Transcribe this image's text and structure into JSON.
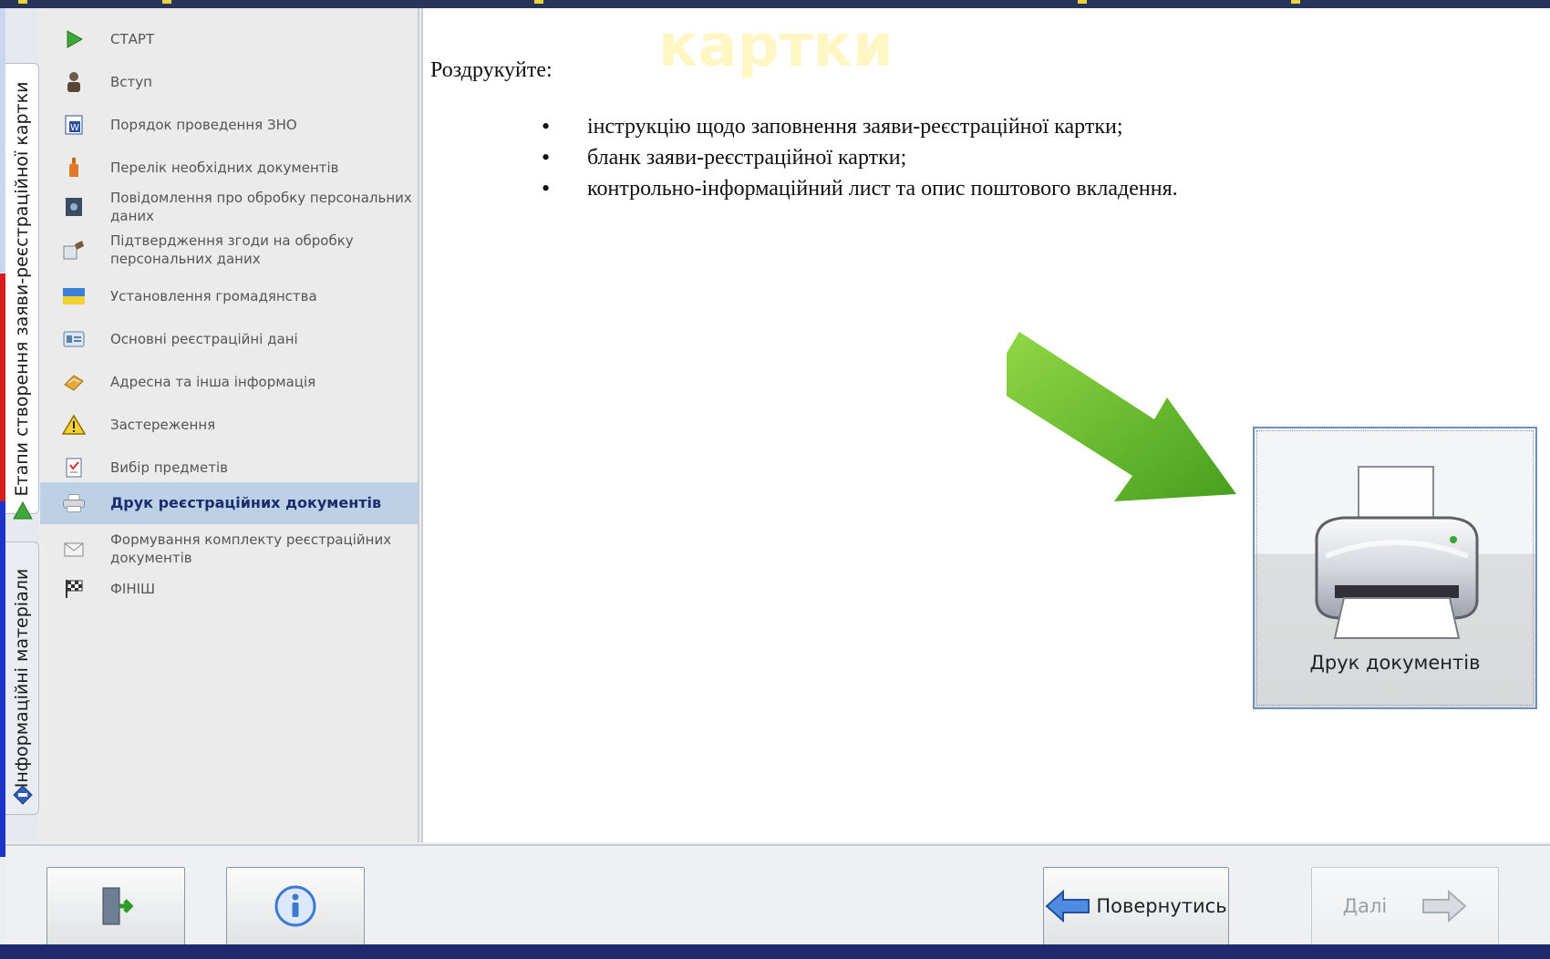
{
  "watermark": "картки",
  "vertical_tabs": {
    "stages": "Етапи створення заяви-реєстраційної картки",
    "info": "Інформаційні матеріали"
  },
  "sidebar": {
    "items": [
      {
        "label": "СТАРТ",
        "icon": "play-icon"
      },
      {
        "label": "Вступ",
        "icon": "person-icon"
      },
      {
        "label": "Порядок проведення ЗНО",
        "icon": "word-document-icon"
      },
      {
        "label": "Перелік необхідних документів",
        "icon": "bottle-icon"
      },
      {
        "label": "Повідомлення про обробку персональних даних",
        "icon": "safe-icon"
      },
      {
        "label": "Підтвердження згоди на обробку персональних даних",
        "icon": "stamp-icon"
      },
      {
        "label": "Установлення громадянства",
        "icon": "ukraine-flag-icon"
      },
      {
        "label": "Основні реєстраційні дані",
        "icon": "id-card-icon"
      },
      {
        "label": "Адресна та інша інформація",
        "icon": "address-book-icon"
      },
      {
        "label": "Застереження",
        "icon": "warning-icon"
      },
      {
        "label": "Вибір предметів",
        "icon": "checklist-icon"
      },
      {
        "label": "Друк реєстраційних документів",
        "icon": "printer-icon",
        "active": true
      },
      {
        "label": "Формування комплекту реєстраційних документів",
        "icon": "envelope-icon"
      },
      {
        "label": "ФІНІШ",
        "icon": "finish-flag-icon"
      }
    ]
  },
  "content": {
    "lead": "Роздрукуйте:",
    "bullets": [
      "інструкцію щодо заповнення заяви-реєстраційної картки;",
      "бланк заяви-реєстраційної картки;",
      "контрольно-інформаційний лист та опис поштового вкладення."
    ],
    "print_button_label": "Друк документів"
  },
  "footer": {
    "exit_icon": "exit-door-icon",
    "info_icon": "info-icon",
    "back_label": "Повернутись",
    "next_label": "Далі"
  },
  "colors": {
    "active_item_bg": "#bcd0e6",
    "active_item_text": "#1a2e6e",
    "arrow_green": "#4fae1a"
  }
}
